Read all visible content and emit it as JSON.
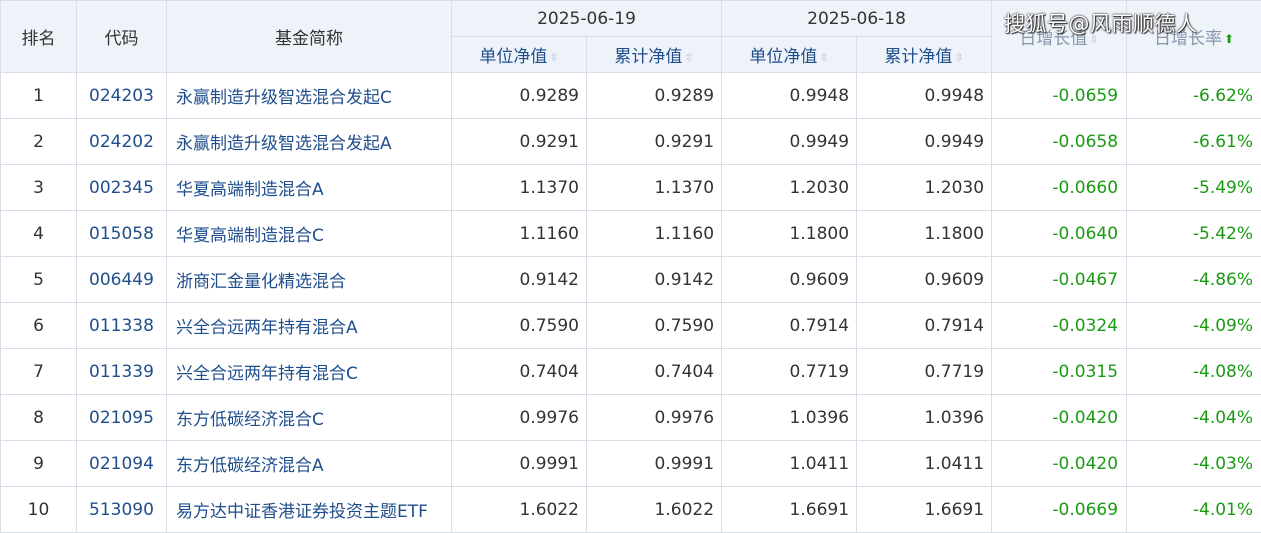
{
  "headers": {
    "rank": "排名",
    "code": "代码",
    "name": "基金简称",
    "date1": "2025-06-19",
    "date2": "2025-06-18",
    "unit_nav": "单位净值",
    "acc_nav": "累计净值",
    "daily_change": "日增长值",
    "daily_rate": "日增长率"
  },
  "sort_icons": {
    "both": "⇳",
    "up": "⬆"
  },
  "watermark": "搜狐号@风雨顺德人",
  "colors": {
    "header_bg": "#eef3fa",
    "link_blue": "#1f4e8c",
    "down_green": "#1a9a12",
    "border": "#d8dee8"
  },
  "rows": [
    {
      "rank": "1",
      "code": "024203",
      "name": "永赢制造升级智选混合发起C",
      "nav1": "0.9289",
      "acc1": "0.9289",
      "nav2": "0.9948",
      "acc2": "0.9948",
      "chg": "-0.0659",
      "rate": "-6.62%"
    },
    {
      "rank": "2",
      "code": "024202",
      "name": "永赢制造升级智选混合发起A",
      "nav1": "0.9291",
      "acc1": "0.9291",
      "nav2": "0.9949",
      "acc2": "0.9949",
      "chg": "-0.0658",
      "rate": "-6.61%"
    },
    {
      "rank": "3",
      "code": "002345",
      "name": "华夏高端制造混合A",
      "nav1": "1.1370",
      "acc1": "1.1370",
      "nav2": "1.2030",
      "acc2": "1.2030",
      "chg": "-0.0660",
      "rate": "-5.49%"
    },
    {
      "rank": "4",
      "code": "015058",
      "name": "华夏高端制造混合C",
      "nav1": "1.1160",
      "acc1": "1.1160",
      "nav2": "1.1800",
      "acc2": "1.1800",
      "chg": "-0.0640",
      "rate": "-5.42%"
    },
    {
      "rank": "5",
      "code": "006449",
      "name": "浙商汇金量化精选混合",
      "nav1": "0.9142",
      "acc1": "0.9142",
      "nav2": "0.9609",
      "acc2": "0.9609",
      "chg": "-0.0467",
      "rate": "-4.86%"
    },
    {
      "rank": "6",
      "code": "011338",
      "name": "兴全合远两年持有混合A",
      "nav1": "0.7590",
      "acc1": "0.7590",
      "nav2": "0.7914",
      "acc2": "0.7914",
      "chg": "-0.0324",
      "rate": "-4.09%"
    },
    {
      "rank": "7",
      "code": "011339",
      "name": "兴全合远两年持有混合C",
      "nav1": "0.7404",
      "acc1": "0.7404",
      "nav2": "0.7719",
      "acc2": "0.7719",
      "chg": "-0.0315",
      "rate": "-4.08%"
    },
    {
      "rank": "8",
      "code": "021095",
      "name": "东方低碳经济混合C",
      "nav1": "0.9976",
      "acc1": "0.9976",
      "nav2": "1.0396",
      "acc2": "1.0396",
      "chg": "-0.0420",
      "rate": "-4.04%"
    },
    {
      "rank": "9",
      "code": "021094",
      "name": "东方低碳经济混合A",
      "nav1": "0.9991",
      "acc1": "0.9991",
      "nav2": "1.0411",
      "acc2": "1.0411",
      "chg": "-0.0420",
      "rate": "-4.03%"
    },
    {
      "rank": "10",
      "code": "513090",
      "name": "易方达中证香港证券投资主题ETF",
      "nav1": "1.6022",
      "acc1": "1.6022",
      "nav2": "1.6691",
      "acc2": "1.6691",
      "chg": "-0.0669",
      "rate": "-4.01%"
    }
  ]
}
